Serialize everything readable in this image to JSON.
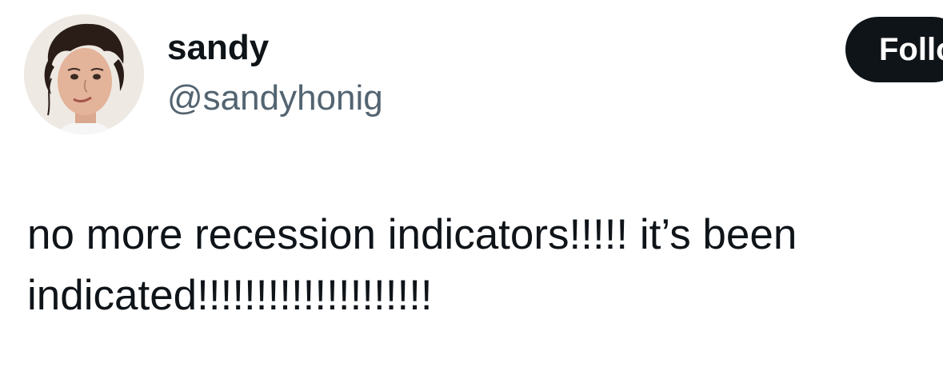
{
  "author": {
    "display_name": "sandy",
    "handle": "@sandyhonig"
  },
  "actions": {
    "follow_label": "Follow"
  },
  "tweet": {
    "lines": [
      "no more recession indicators!!!!! it’s been",
      "indicated!!!!!!!!!!!!!!!!!!!!"
    ]
  },
  "colors": {
    "text_primary": "#0f1419",
    "text_secondary": "#536471",
    "button_bg": "#0f1419",
    "button_text": "#ffffff",
    "background": "#ffffff"
  }
}
